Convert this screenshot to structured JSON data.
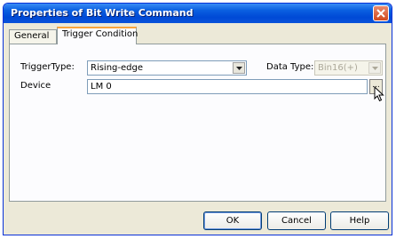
{
  "window": {
    "title": "Properties of Bit Write Command"
  },
  "tabs": [
    {
      "label": "General"
    },
    {
      "label": "Trigger Condition"
    }
  ],
  "trigger": {
    "type_label": "TriggerType:",
    "type_value": "Rising-edge",
    "data_type_label": "Data Type:",
    "data_type_value": "Bin16(+)",
    "device_label": "Device",
    "device_value": "LM 0",
    "browse_label": "..."
  },
  "buttons": {
    "ok": "OK",
    "cancel": "Cancel",
    "help": "Help"
  },
  "icons": {
    "close": "close-icon",
    "dropdown": "chevron-down-icon",
    "cursor": "pointer-cursor"
  },
  "colors": {
    "titlebar": "#0a5fe0",
    "close": "#d24a1f",
    "active_tab_accent": "#f9a43c",
    "dialog_bg": "#ece9d8"
  }
}
